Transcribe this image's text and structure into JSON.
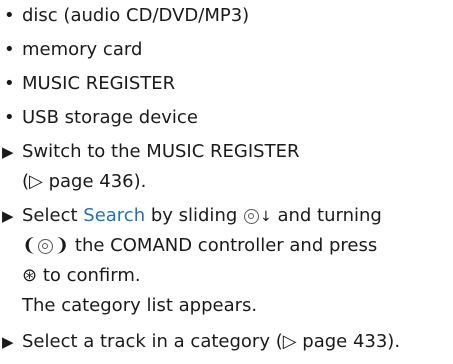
{
  "bullets": [
    "disc (audio CD/DVD/MP3)",
    "memory card",
    "MUSIC REGISTER",
    "USB storage device"
  ],
  "marker_bullet": "•",
  "marker_step": "▶",
  "step1": {
    "text": "Switch to the MUSIC REGISTER",
    "ref": "(▷ page 436)."
  },
  "step2": {
    "prefix": "Select ",
    "highlight": "Search",
    "after_highlight": " by sliding ",
    "slide_arrow": "↓",
    "after_slide": " and turning",
    "turn_left": "❨",
    "turn_right": "❩",
    "after_turn": " the COMAND controller and press",
    "press_symbol": "⊛",
    "after_press": " to confirm.",
    "result": "The category list appears."
  },
  "step3": {
    "text": "Select a track in a category (▷ page 433)."
  },
  "colors": {
    "highlight": "#1f6fc5",
    "text": "#1a1a1a"
  }
}
